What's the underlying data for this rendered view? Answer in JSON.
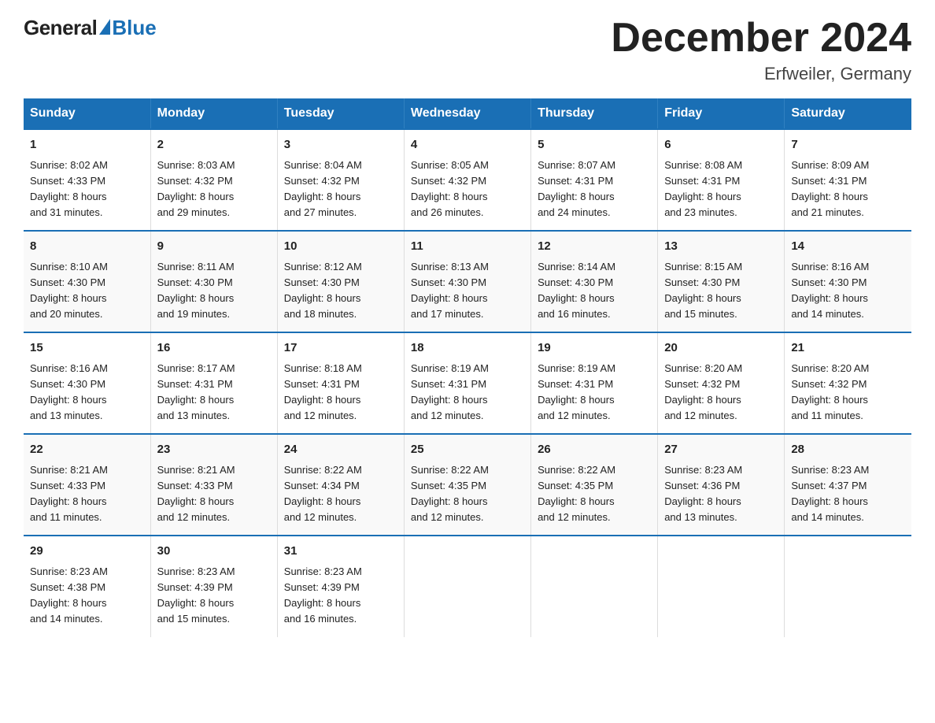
{
  "logo": {
    "general": "General",
    "blue": "Blue"
  },
  "header": {
    "month_year": "December 2024",
    "location": "Erfweiler, Germany"
  },
  "days_of_week": [
    "Sunday",
    "Monday",
    "Tuesday",
    "Wednesday",
    "Thursday",
    "Friday",
    "Saturday"
  ],
  "weeks": [
    [
      {
        "day": "1",
        "sunrise": "8:02 AM",
        "sunset": "4:33 PM",
        "daylight": "8 hours and 31 minutes."
      },
      {
        "day": "2",
        "sunrise": "8:03 AM",
        "sunset": "4:32 PM",
        "daylight": "8 hours and 29 minutes."
      },
      {
        "day": "3",
        "sunrise": "8:04 AM",
        "sunset": "4:32 PM",
        "daylight": "8 hours and 27 minutes."
      },
      {
        "day": "4",
        "sunrise": "8:05 AM",
        "sunset": "4:32 PM",
        "daylight": "8 hours and 26 minutes."
      },
      {
        "day": "5",
        "sunrise": "8:07 AM",
        "sunset": "4:31 PM",
        "daylight": "8 hours and 24 minutes."
      },
      {
        "day": "6",
        "sunrise": "8:08 AM",
        "sunset": "4:31 PM",
        "daylight": "8 hours and 23 minutes."
      },
      {
        "day": "7",
        "sunrise": "8:09 AM",
        "sunset": "4:31 PM",
        "daylight": "8 hours and 21 minutes."
      }
    ],
    [
      {
        "day": "8",
        "sunrise": "8:10 AM",
        "sunset": "4:30 PM",
        "daylight": "8 hours and 20 minutes."
      },
      {
        "day": "9",
        "sunrise": "8:11 AM",
        "sunset": "4:30 PM",
        "daylight": "8 hours and 19 minutes."
      },
      {
        "day": "10",
        "sunrise": "8:12 AM",
        "sunset": "4:30 PM",
        "daylight": "8 hours and 18 minutes."
      },
      {
        "day": "11",
        "sunrise": "8:13 AM",
        "sunset": "4:30 PM",
        "daylight": "8 hours and 17 minutes."
      },
      {
        "day": "12",
        "sunrise": "8:14 AM",
        "sunset": "4:30 PM",
        "daylight": "8 hours and 16 minutes."
      },
      {
        "day": "13",
        "sunrise": "8:15 AM",
        "sunset": "4:30 PM",
        "daylight": "8 hours and 15 minutes."
      },
      {
        "day": "14",
        "sunrise": "8:16 AM",
        "sunset": "4:30 PM",
        "daylight": "8 hours and 14 minutes."
      }
    ],
    [
      {
        "day": "15",
        "sunrise": "8:16 AM",
        "sunset": "4:30 PM",
        "daylight": "8 hours and 13 minutes."
      },
      {
        "day": "16",
        "sunrise": "8:17 AM",
        "sunset": "4:31 PM",
        "daylight": "8 hours and 13 minutes."
      },
      {
        "day": "17",
        "sunrise": "8:18 AM",
        "sunset": "4:31 PM",
        "daylight": "8 hours and 12 minutes."
      },
      {
        "day": "18",
        "sunrise": "8:19 AM",
        "sunset": "4:31 PM",
        "daylight": "8 hours and 12 minutes."
      },
      {
        "day": "19",
        "sunrise": "8:19 AM",
        "sunset": "4:31 PM",
        "daylight": "8 hours and 12 minutes."
      },
      {
        "day": "20",
        "sunrise": "8:20 AM",
        "sunset": "4:32 PM",
        "daylight": "8 hours and 12 minutes."
      },
      {
        "day": "21",
        "sunrise": "8:20 AM",
        "sunset": "4:32 PM",
        "daylight": "8 hours and 11 minutes."
      }
    ],
    [
      {
        "day": "22",
        "sunrise": "8:21 AM",
        "sunset": "4:33 PM",
        "daylight": "8 hours and 11 minutes."
      },
      {
        "day": "23",
        "sunrise": "8:21 AM",
        "sunset": "4:33 PM",
        "daylight": "8 hours and 12 minutes."
      },
      {
        "day": "24",
        "sunrise": "8:22 AM",
        "sunset": "4:34 PM",
        "daylight": "8 hours and 12 minutes."
      },
      {
        "day": "25",
        "sunrise": "8:22 AM",
        "sunset": "4:35 PM",
        "daylight": "8 hours and 12 minutes."
      },
      {
        "day": "26",
        "sunrise": "8:22 AM",
        "sunset": "4:35 PM",
        "daylight": "8 hours and 12 minutes."
      },
      {
        "day": "27",
        "sunrise": "8:23 AM",
        "sunset": "4:36 PM",
        "daylight": "8 hours and 13 minutes."
      },
      {
        "day": "28",
        "sunrise": "8:23 AM",
        "sunset": "4:37 PM",
        "daylight": "8 hours and 14 minutes."
      }
    ],
    [
      {
        "day": "29",
        "sunrise": "8:23 AM",
        "sunset": "4:38 PM",
        "daylight": "8 hours and 14 minutes."
      },
      {
        "day": "30",
        "sunrise": "8:23 AM",
        "sunset": "4:39 PM",
        "daylight": "8 hours and 15 minutes."
      },
      {
        "day": "31",
        "sunrise": "8:23 AM",
        "sunset": "4:39 PM",
        "daylight": "8 hours and 16 minutes."
      },
      null,
      null,
      null,
      null
    ]
  ],
  "labels": {
    "sunrise": "Sunrise:",
    "sunset": "Sunset:",
    "daylight": "Daylight:"
  }
}
